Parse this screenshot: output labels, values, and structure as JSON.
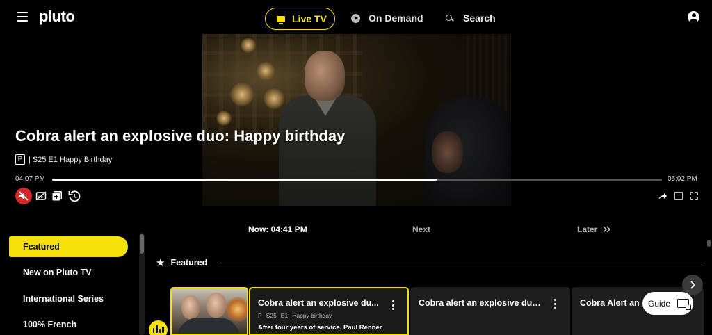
{
  "nav": {
    "logo": "pluto",
    "live_tv": "Live TV",
    "on_demand": "On Demand",
    "search": "Search"
  },
  "player": {
    "title": "Cobra alert an explosive duo: Happy birthday",
    "rating": "P",
    "episode_info": "| S25 E1 Happy Birthday",
    "start_time": "04:07 PM",
    "end_time": "05:02 PM",
    "progress": 0.63
  },
  "schedule": {
    "now": "Now: 04:41 PM",
    "next": "Next",
    "later": "Later"
  },
  "sidebar": {
    "items": [
      {
        "label": "Featured",
        "active": true
      },
      {
        "label": "New on Pluto TV"
      },
      {
        "label": "International Series"
      },
      {
        "label": "100% French"
      }
    ]
  },
  "featured": {
    "header": "Featured",
    "cards": [
      {
        "title": "Cobra alert an explosive du...",
        "rating": "P",
        "season": "S25",
        "episode": "E1",
        "episode_title": "Happy birthday",
        "description": "After four years of service, Paul Renner"
      },
      {
        "title": "Cobra alert an explosive duo..."
      },
      {
        "title": "Cobra Alert an"
      }
    ]
  },
  "guide_button": "Guide",
  "colors": {
    "accent": "#f5e10a",
    "mute_red": "#d6262b"
  }
}
